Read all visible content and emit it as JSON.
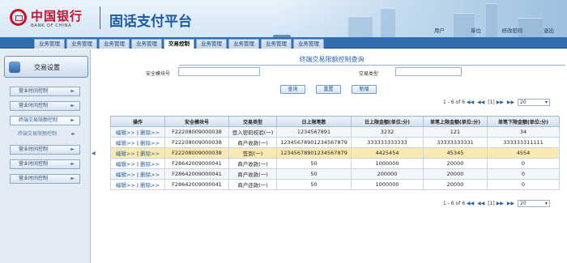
{
  "header": {
    "bank_name_cn": "中国银行",
    "bank_name_en": "BANK OF CHINA",
    "platform_title": "固话支付平台",
    "links": [
      "用户",
      "单位",
      "修改密码",
      "退出"
    ]
  },
  "nav": {
    "tabs": [
      "业务管理",
      "业务管理",
      "业务管理",
      "业务管理",
      "交易控制",
      "业务管理",
      "业务管理",
      "业务管理",
      "业务管理"
    ],
    "active_index": 4
  },
  "sidebar": {
    "title": "交易设置",
    "items": [
      "营业时间控制",
      "营业时间控制",
      "终端交易限额控制",
      "终端交易限额控制",
      "营业时间控制",
      "营业时间控制",
      "营业时间控制"
    ],
    "active_index": 2,
    "arrow": "►",
    "toggle": "◀"
  },
  "main": {
    "title": "终端交易限额控制查询",
    "form": {
      "module_label": "安全模块号",
      "module_value": "",
      "type_label": "交易类型",
      "type_value": ""
    },
    "buttons": {
      "query": "查询",
      "reset": "重置",
      "add": "新增"
    },
    "pager_top": {
      "info": "1 - 6 of 6",
      "first": "◀◀",
      "prev": "◀◀",
      "page": "[1]",
      "next": "▶▶",
      "last": "▶▶",
      "page_size": "20"
    },
    "pager_bottom": {
      "info": "1 - 6 of 6",
      "first": "◀◀",
      "prev": "◀◀",
      "page": "[1]",
      "next": "▶▶",
      "last": "▶▶",
      "page_size": "20"
    },
    "table": {
      "columns": [
        "操作",
        "安全模块号",
        "交易类型",
        "日上限笔数",
        "日上限金额(单位:分)",
        "单笔上限金额(单位:分)",
        "单笔下限金额(单位:分)"
      ],
      "edit_label": "编辑>>",
      "sep": "|",
      "delete_label": "删除>>",
      "rows": [
        [
          "F22208009000038",
          "登入密码校验(一)",
          "1234567891",
          "3232",
          "121",
          "34"
        ],
        [
          "F22208009000038",
          "商户收款(一)",
          "12345678901234567879",
          "333333333333",
          "33333333331",
          "333333311111"
        ],
        [
          "F22208009000038",
          "签到(一)",
          "12345678901234567879",
          "4425454",
          "45345",
          "4554"
        ],
        [
          "F28642009000041",
          "商户收款(一)",
          "50",
          "1000000",
          "20000",
          "0"
        ],
        [
          "F28642009000041",
          "商户收款(一)",
          "50",
          "200000",
          "20000",
          "0"
        ],
        [
          "F28642009000041",
          "商户还款(一)",
          "50",
          "1000000",
          "20000",
          "0"
        ]
      ],
      "highlight_index": 2
    }
  }
}
